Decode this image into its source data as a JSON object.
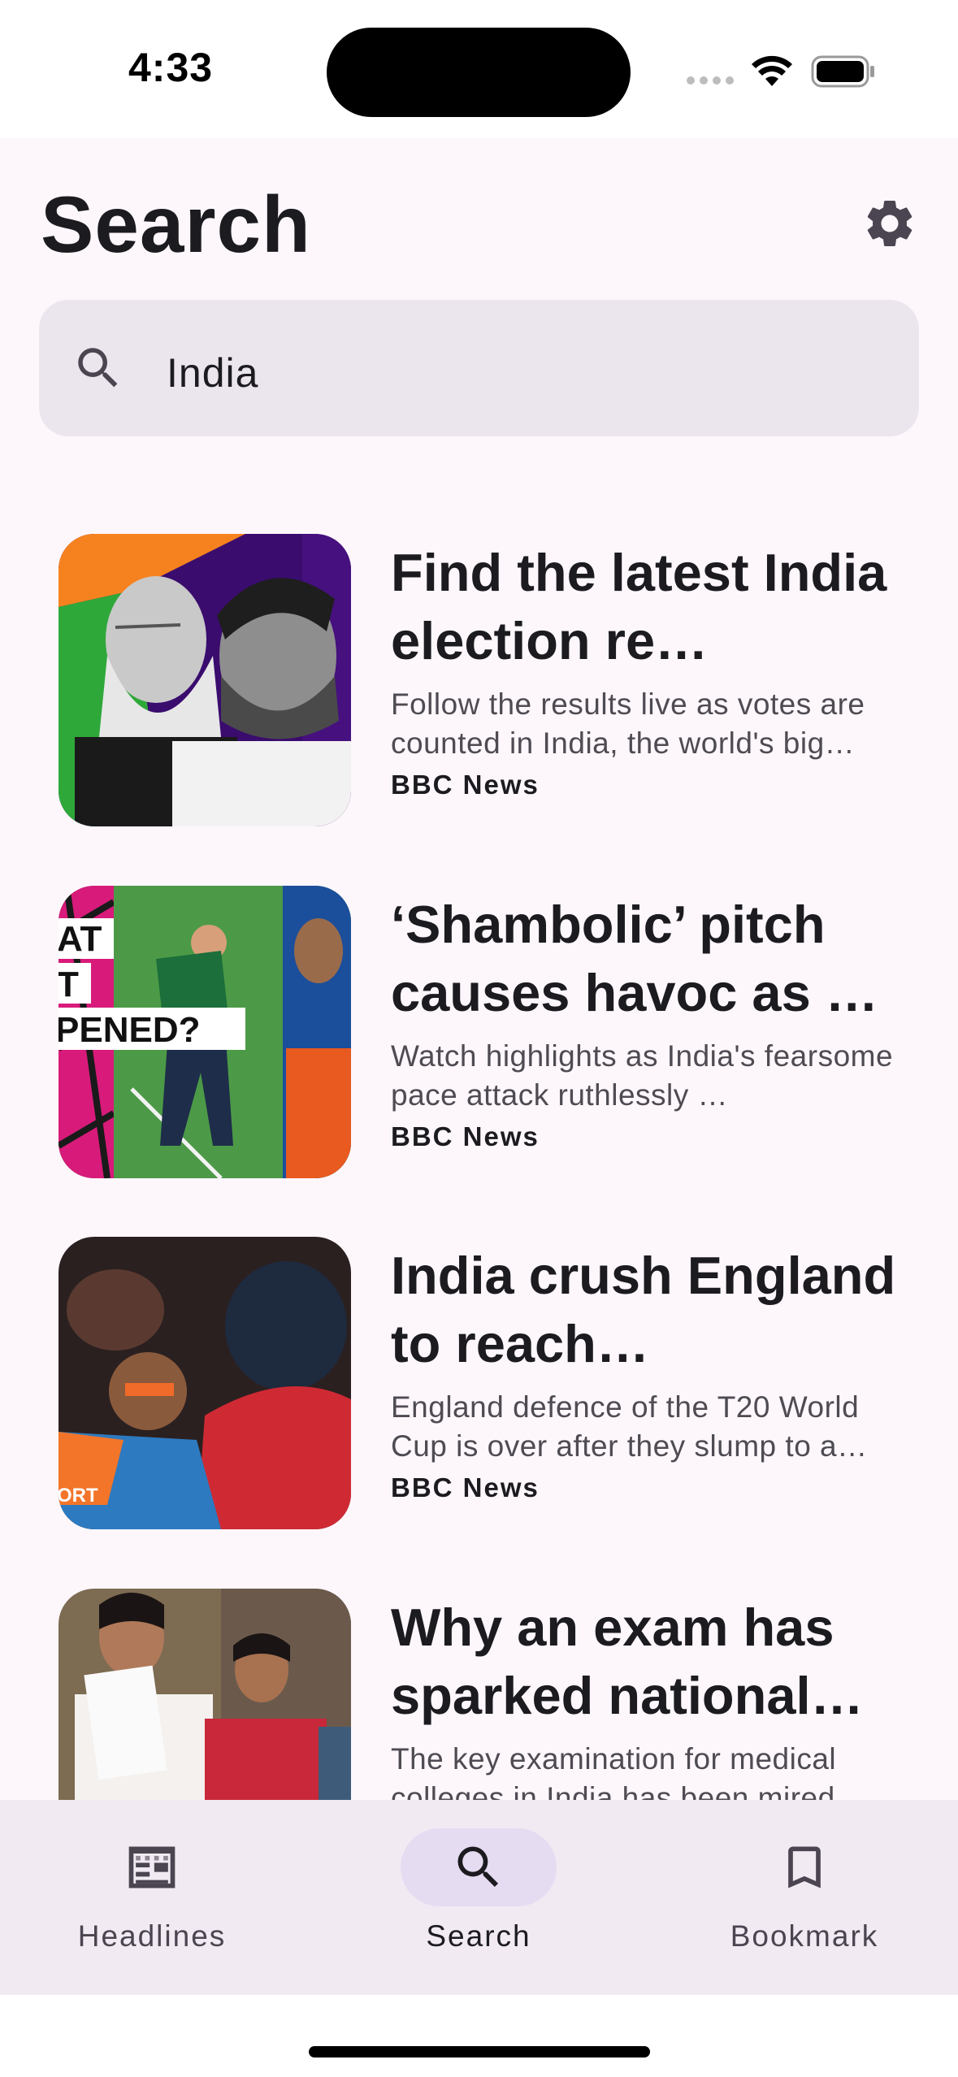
{
  "status_bar": {
    "time": "4:33"
  },
  "header": {
    "title": "Search"
  },
  "search": {
    "value": "India"
  },
  "results": [
    {
      "title": "Find the latest India election re…",
      "description": "Follow the results live as votes are counted in India, the world's big…",
      "source": "BBC News"
    },
    {
      "title": "‘Shambolic’ pitch causes havoc as …",
      "description": "Watch highlights as India's fearsome pace attack ruthlessly …",
      "source": "BBC News",
      "thumb_text": [
        "AT",
        "T",
        "PENED?"
      ]
    },
    {
      "title": "India crush England to reach…",
      "description": "England defence of the T20 World Cup is over after they slump to a…",
      "source": "BBC News",
      "thumb_text": "ORT"
    },
    {
      "title": "Why an exam has sparked national…",
      "description": "The key examination for medical colleges in India has been mired…",
      "source": ""
    }
  ],
  "bottom_nav": [
    {
      "label": "Headlines",
      "icon": "newspaper-icon",
      "active": false
    },
    {
      "label": "Search",
      "icon": "search-icon",
      "active": true
    },
    {
      "label": "Bookmark",
      "icon": "bookmark-icon",
      "active": false
    }
  ],
  "colors": {
    "background": "#fdf7fc",
    "search_field": "#ebe5ee",
    "nav_background": "#f1eaf3",
    "nav_active_pill": "#e6dcf2",
    "text_primary": "#1c1b1f",
    "text_secondary": "#4f4b52"
  }
}
